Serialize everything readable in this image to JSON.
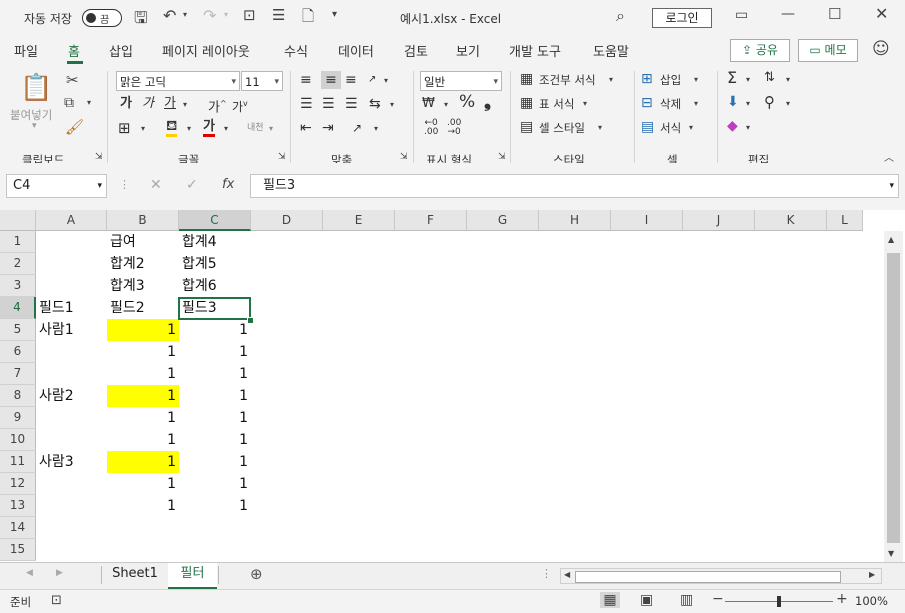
{
  "titlebar": {
    "autosave_label": "자동 저장",
    "autosave_state": "끔",
    "title": "예시1.xlsx  -  Excel",
    "login": "로그인"
  },
  "tabs": [
    "파일",
    "홈",
    "삽입",
    "페이지 레이아웃",
    "수식",
    "데이터",
    "검토",
    "보기",
    "개발 도구",
    "도움말"
  ],
  "active_tab": "홈",
  "share": "공유",
  "memo": "메모",
  "ribbon": {
    "paste": "붙여넣기",
    "font_name": "맑은 고딕",
    "font_size": "11",
    "number_format": "일반",
    "cond_format": "조건부 서식",
    "table_format": "표 서식",
    "cell_style": "셀 스타일",
    "insert": "삽입",
    "delete": "삭제",
    "format": "서식",
    "groups": [
      "클립보드",
      "글꼴",
      "맞춤",
      "표시 형식",
      "스타일",
      "셀",
      "편집"
    ]
  },
  "formula_bar": {
    "name_box": "C4",
    "content": "필드3"
  },
  "columns": [
    "A",
    "B",
    "C",
    "D",
    "E",
    "F",
    "G",
    "H",
    "I",
    "J",
    "K",
    "L"
  ],
  "rows": [
    "1",
    "2",
    "3",
    "4",
    "5",
    "6",
    "7",
    "8",
    "9",
    "10",
    "11",
    "12",
    "13",
    "14",
    "15"
  ],
  "cells": {
    "B1": "급여",
    "C1": "합계4",
    "B2": "합계2",
    "C2": "합계5",
    "B3": "합계3",
    "C3": "합계6",
    "A4": "필드1",
    "B4": "필드2",
    "C4": "필드3",
    "A5": "사람1",
    "B5": "1",
    "C5": "1",
    "B6": "1",
    "C6": "1",
    "B7": "1",
    "C7": "1",
    "A8": "사람2",
    "B8": "1",
    "C8": "1",
    "B9": "1",
    "C9": "1",
    "B10": "1",
    "C10": "1",
    "A11": "사람3",
    "B11": "1",
    "C11": "1",
    "B12": "1",
    "C12": "1",
    "B13": "1",
    "C13": "1"
  },
  "highlight_color": "#ffff00",
  "accent_color": "#217346",
  "sheets": [
    "Sheet1",
    "필터"
  ],
  "active_sheet": "필터",
  "status": {
    "ready": "준비",
    "zoom": "100%"
  }
}
